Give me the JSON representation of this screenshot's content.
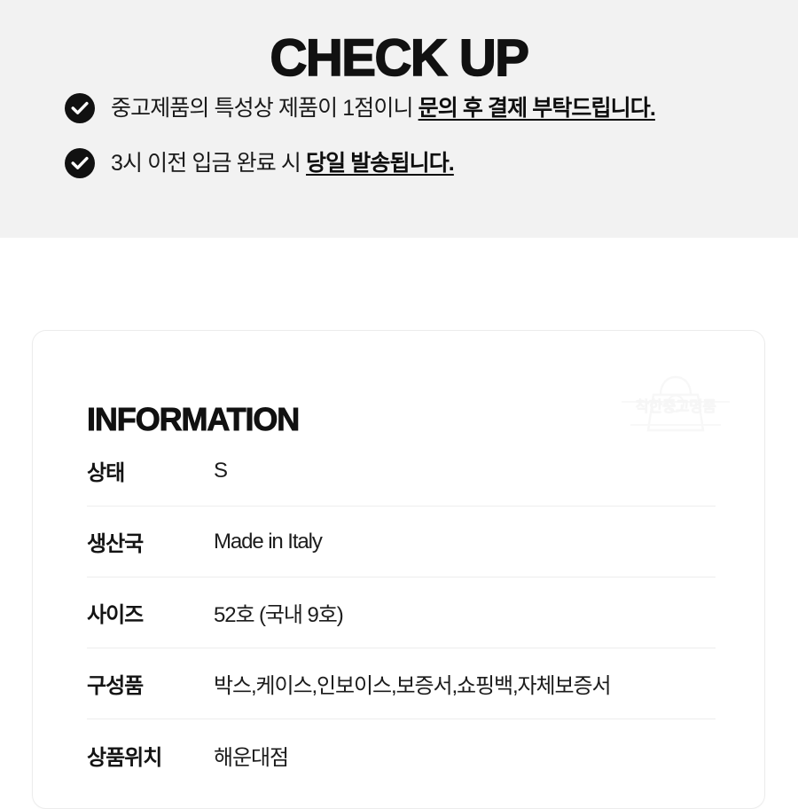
{
  "checkup": {
    "title": "CHECK UP",
    "items": [
      {
        "icon": "check-circle-icon",
        "text_plain": "중고제품의 특성상 제품이 1점이니 ",
        "text_emphasis": "문의 후 결제 부탁드립니다."
      },
      {
        "icon": "check-circle-icon",
        "text_plain": "3시 이전 입금 완료 시 ",
        "text_emphasis": "당일 발송됩니다."
      }
    ]
  },
  "information": {
    "heading": "INFORMATION",
    "watermark": {
      "icon": "shopping-bag-icon",
      "label": "착한중고명품"
    },
    "rows": [
      {
        "label": "상태",
        "value": "S"
      },
      {
        "label": "생산국",
        "value": "Made in Italy"
      },
      {
        "label": "사이즈",
        "value": "52호 (국내 9호)"
      },
      {
        "label": "구성품",
        "value": "박스,케이스,인보이스,보증서,쇼핑백,자체보증서"
      },
      {
        "label": "상품위치",
        "value": "해운대점"
      }
    ]
  },
  "colors": {
    "section_background": "#f2f2f2",
    "page_background": "#ffffff",
    "text_primary": "#111111",
    "icon_fill": "#111111",
    "icon_glyph": "#ffffff",
    "divider": "#ededed",
    "card_border": "#ececec"
  }
}
